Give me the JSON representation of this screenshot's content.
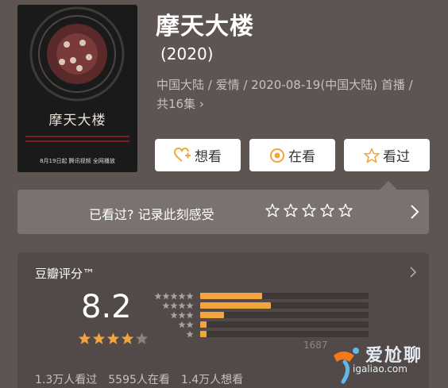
{
  "poster": {
    "title": "摩天大楼",
    "date_line": "8月19日起  腾讯视频  全网播放"
  },
  "movie": {
    "title": "摩天大楼",
    "year": "(2020)",
    "meta": "中国大陆 / 爱情 / 2020-08-19(中国大陆) 首播 / 共16集 ›"
  },
  "actions": {
    "want_label": "想看",
    "watching_label": "在看",
    "watched_label": "看过"
  },
  "prompt": {
    "text": "已看过? 记录此刻感受",
    "stars": 5
  },
  "rating": {
    "title": "豆瓣评分™",
    "score": "8.2",
    "score_stars": 4,
    "distribution": [
      {
        "stars": 5,
        "fraction": 0.37
      },
      {
        "stars": 4,
        "fraction": 0.42
      },
      {
        "stars": 3,
        "fraction": 0.14
      },
      {
        "stars": 2,
        "fraction": 0.04
      },
      {
        "stars": 1,
        "fraction": 0.04
      }
    ],
    "count_text": "1687",
    "stats": [
      "1.3万人看过",
      "5595人在看",
      "1.4万人想看"
    ]
  },
  "watermark": {
    "line1": "爱尬聊",
    "line2": "igaliao.com"
  },
  "colors": {
    "background": "#5e5553",
    "accent": "#f3a43d",
    "card": "#524a48"
  }
}
